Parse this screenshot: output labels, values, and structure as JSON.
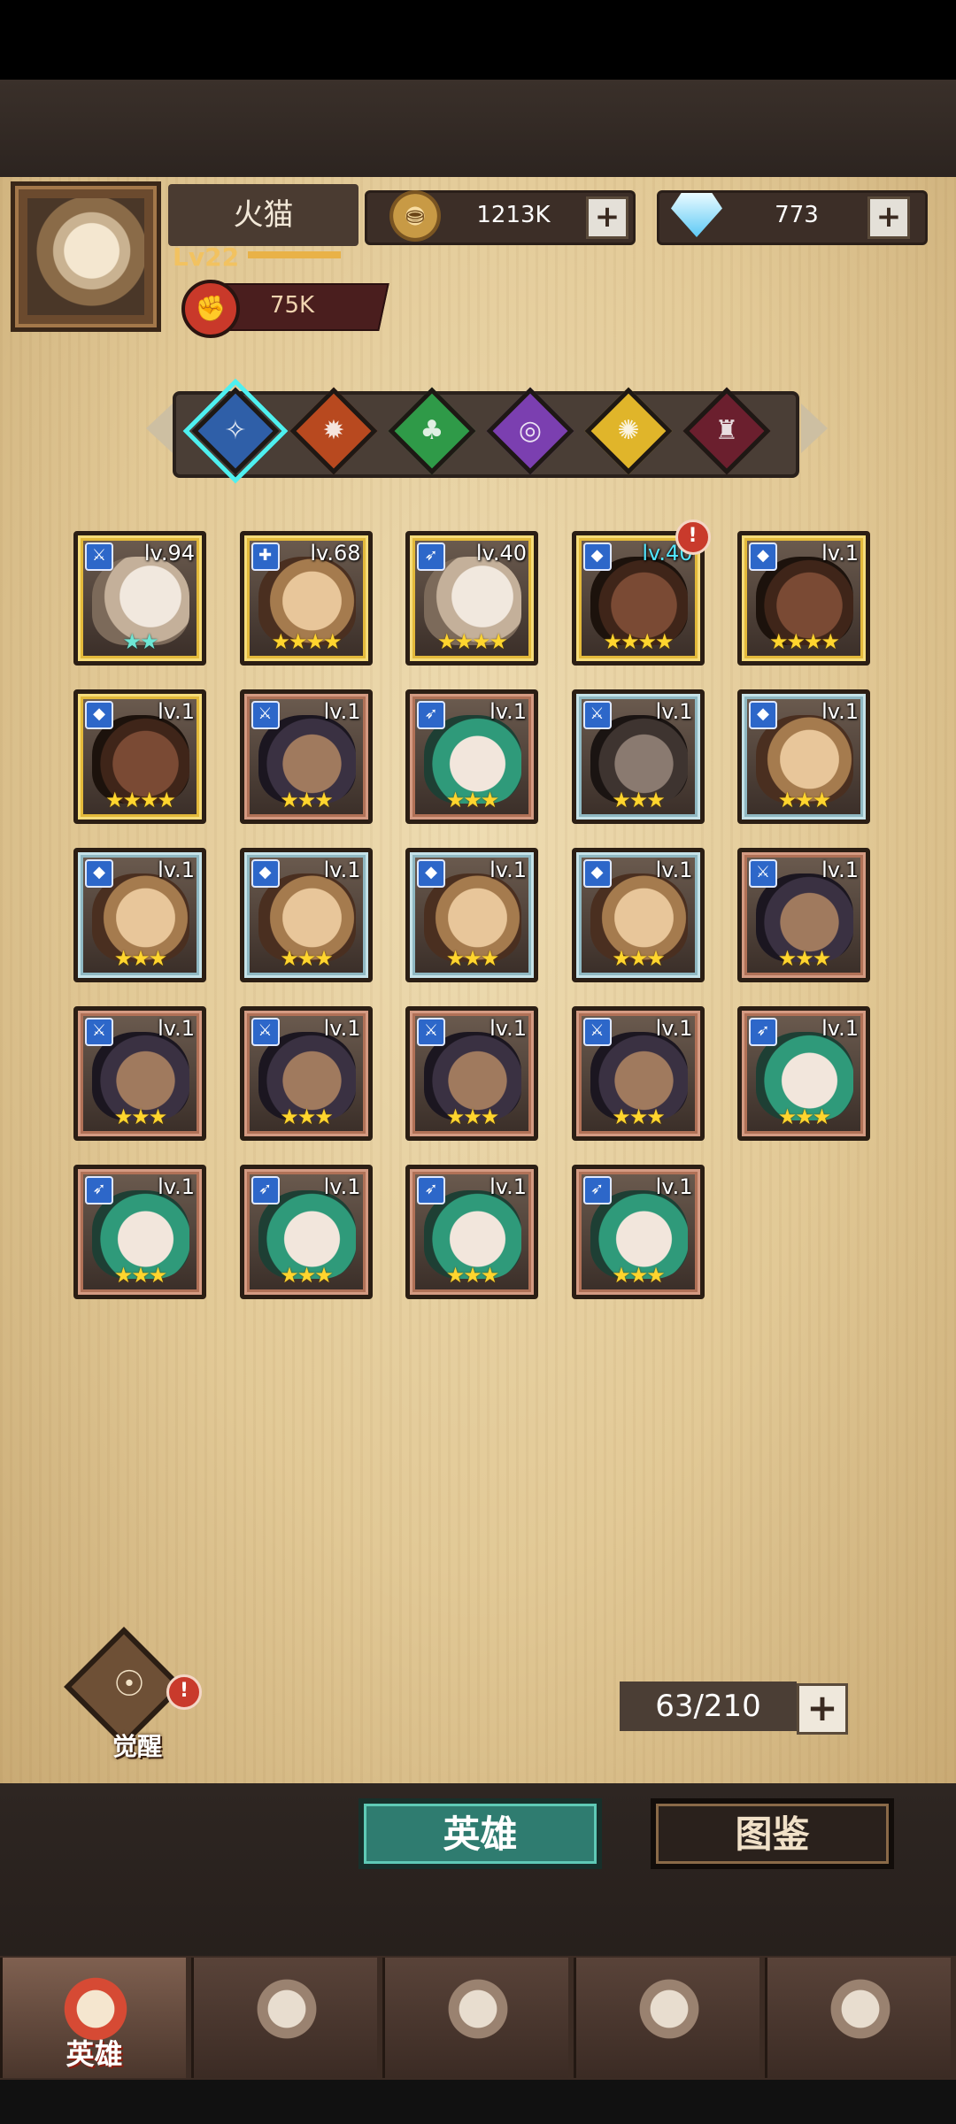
{
  "player": {
    "name": "火猫",
    "level": "Lv22",
    "level_progress": 0.6,
    "power": "75K",
    "avatar_icon": "knight-avatar"
  },
  "currency": {
    "gold": "1213K",
    "gems": "773",
    "gold_icon": "coin-icon",
    "gem_icon": "diamond-icon"
  },
  "factions": [
    {
      "icon": "order-faction-icon",
      "color": "#2f5fa8",
      "selected": true
    },
    {
      "icon": "fire-faction-icon",
      "color": "#b8491f",
      "selected": false
    },
    {
      "icon": "nature-faction-icon",
      "color": "#2f9a48",
      "selected": false
    },
    {
      "icon": "chaos-faction-icon",
      "color": "#7b3fb0",
      "selected": false
    },
    {
      "icon": "light-faction-icon",
      "color": "#e0b52a",
      "selected": false
    },
    {
      "icon": "dark-faction-icon",
      "color": "#6b1f2e",
      "selected": false
    }
  ],
  "heroes": [
    {
      "level": "lv.94",
      "stars": "★★",
      "frame": "gold",
      "alert": false
    },
    {
      "level": "lv.68",
      "stars": "★★★★",
      "frame": "gold",
      "alert": false
    },
    {
      "level": "lv.40",
      "stars": "★★★★",
      "frame": "gold",
      "alert": false
    },
    {
      "level": "lv.40",
      "stars": "★★★★",
      "frame": "gold",
      "alert": true
    },
    {
      "level": "lv.1",
      "stars": "★★★★",
      "frame": "gold",
      "alert": false
    },
    {
      "level": "lv.1",
      "stars": "★★★★",
      "frame": "gold",
      "alert": false
    },
    {
      "level": "lv.1",
      "stars": "★★★",
      "frame": "red",
      "alert": false
    },
    {
      "level": "lv.1",
      "stars": "★★★",
      "frame": "red",
      "alert": false
    },
    {
      "level": "lv.1",
      "stars": "★★★",
      "frame": "blue",
      "alert": false
    },
    {
      "level": "lv.1",
      "stars": "★★★",
      "frame": "blue",
      "alert": false
    },
    {
      "level": "lv.1",
      "stars": "★★★",
      "frame": "blue",
      "alert": false
    },
    {
      "level": "lv.1",
      "stars": "★★★",
      "frame": "blue",
      "alert": false
    },
    {
      "level": "lv.1",
      "stars": "★★★",
      "frame": "blue",
      "alert": false
    },
    {
      "level": "lv.1",
      "stars": "★★★",
      "frame": "blue",
      "alert": false
    },
    {
      "level": "lv.1",
      "stars": "★★★",
      "frame": "red",
      "alert": false
    },
    {
      "level": "lv.1",
      "stars": "★★★",
      "frame": "red",
      "alert": false
    },
    {
      "level": "lv.1",
      "stars": "★★★",
      "frame": "red",
      "alert": false
    },
    {
      "level": "lv.1",
      "stars": "★★★",
      "frame": "red",
      "alert": false
    },
    {
      "level": "lv.1",
      "stars": "★★★",
      "frame": "red",
      "alert": false
    },
    {
      "level": "lv.1",
      "stars": "★★★",
      "frame": "red",
      "alert": false
    },
    {
      "level": "lv.1",
      "stars": "★★★",
      "frame": "red",
      "alert": false
    },
    {
      "level": "lv.1",
      "stars": "★★★",
      "frame": "red",
      "alert": false
    },
    {
      "level": "lv.1",
      "stars": "★★★",
      "frame": "red",
      "alert": false
    },
    {
      "level": "lv.1",
      "stars": "★★★",
      "frame": "red",
      "alert": false
    }
  ],
  "awaken": {
    "label": "觉醒",
    "alert": true
  },
  "capacity": {
    "text": "63/210"
  },
  "tabs": {
    "heroes": "英雄",
    "codex": "图鉴"
  },
  "nav": [
    {
      "label": "英雄",
      "icon": "helmet-icon",
      "active": true
    },
    {
      "label": "",
      "icon": "banner-icon",
      "active": false
    },
    {
      "label": "",
      "icon": "battle-swords-icon",
      "active": false
    },
    {
      "label": "",
      "icon": "tower-icon",
      "active": false
    },
    {
      "label": "",
      "icon": "guild-handshake-icon",
      "active": false
    }
  ]
}
